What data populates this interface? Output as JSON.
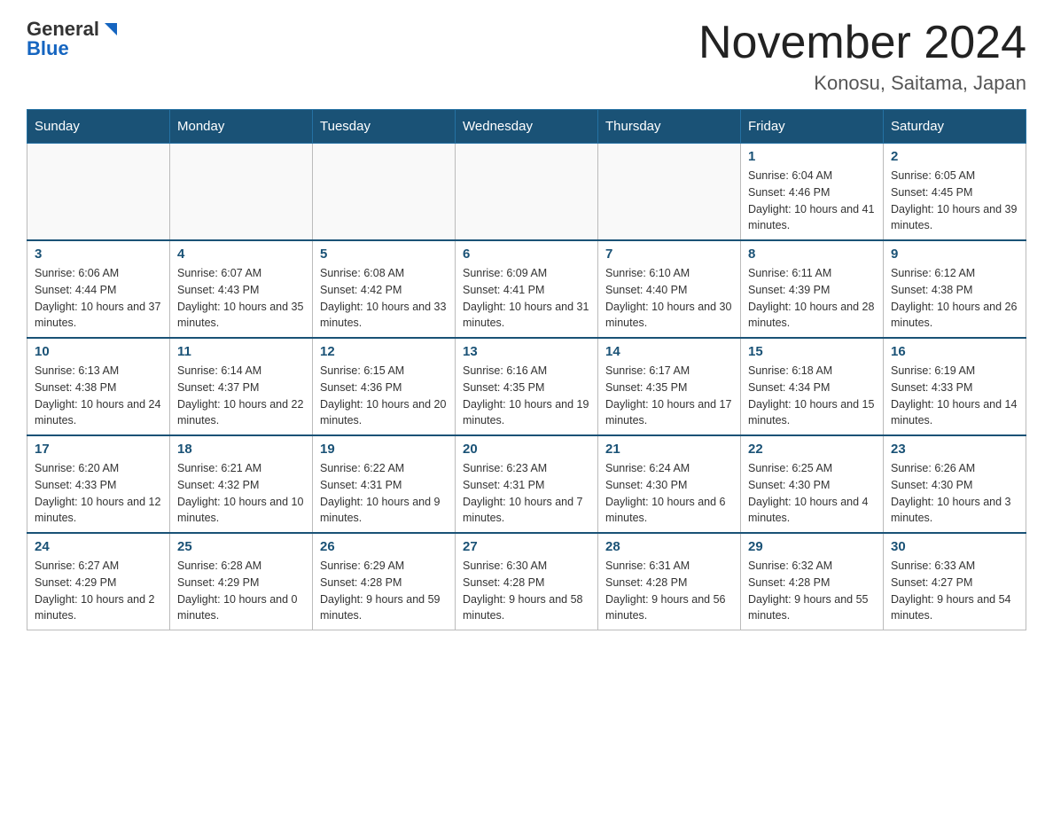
{
  "header": {
    "logo_general": "General",
    "logo_blue": "Blue",
    "title": "November 2024",
    "subtitle": "Konosu, Saitama, Japan"
  },
  "days_of_week": [
    "Sunday",
    "Monday",
    "Tuesday",
    "Wednesday",
    "Thursday",
    "Friday",
    "Saturday"
  ],
  "weeks": [
    [
      {
        "day": "",
        "info": ""
      },
      {
        "day": "",
        "info": ""
      },
      {
        "day": "",
        "info": ""
      },
      {
        "day": "",
        "info": ""
      },
      {
        "day": "",
        "info": ""
      },
      {
        "day": "1",
        "info": "Sunrise: 6:04 AM\nSunset: 4:46 PM\nDaylight: 10 hours and 41 minutes."
      },
      {
        "day": "2",
        "info": "Sunrise: 6:05 AM\nSunset: 4:45 PM\nDaylight: 10 hours and 39 minutes."
      }
    ],
    [
      {
        "day": "3",
        "info": "Sunrise: 6:06 AM\nSunset: 4:44 PM\nDaylight: 10 hours and 37 minutes."
      },
      {
        "day": "4",
        "info": "Sunrise: 6:07 AM\nSunset: 4:43 PM\nDaylight: 10 hours and 35 minutes."
      },
      {
        "day": "5",
        "info": "Sunrise: 6:08 AM\nSunset: 4:42 PM\nDaylight: 10 hours and 33 minutes."
      },
      {
        "day": "6",
        "info": "Sunrise: 6:09 AM\nSunset: 4:41 PM\nDaylight: 10 hours and 31 minutes."
      },
      {
        "day": "7",
        "info": "Sunrise: 6:10 AM\nSunset: 4:40 PM\nDaylight: 10 hours and 30 minutes."
      },
      {
        "day": "8",
        "info": "Sunrise: 6:11 AM\nSunset: 4:39 PM\nDaylight: 10 hours and 28 minutes."
      },
      {
        "day": "9",
        "info": "Sunrise: 6:12 AM\nSunset: 4:38 PM\nDaylight: 10 hours and 26 minutes."
      }
    ],
    [
      {
        "day": "10",
        "info": "Sunrise: 6:13 AM\nSunset: 4:38 PM\nDaylight: 10 hours and 24 minutes."
      },
      {
        "day": "11",
        "info": "Sunrise: 6:14 AM\nSunset: 4:37 PM\nDaylight: 10 hours and 22 minutes."
      },
      {
        "day": "12",
        "info": "Sunrise: 6:15 AM\nSunset: 4:36 PM\nDaylight: 10 hours and 20 minutes."
      },
      {
        "day": "13",
        "info": "Sunrise: 6:16 AM\nSunset: 4:35 PM\nDaylight: 10 hours and 19 minutes."
      },
      {
        "day": "14",
        "info": "Sunrise: 6:17 AM\nSunset: 4:35 PM\nDaylight: 10 hours and 17 minutes."
      },
      {
        "day": "15",
        "info": "Sunrise: 6:18 AM\nSunset: 4:34 PM\nDaylight: 10 hours and 15 minutes."
      },
      {
        "day": "16",
        "info": "Sunrise: 6:19 AM\nSunset: 4:33 PM\nDaylight: 10 hours and 14 minutes."
      }
    ],
    [
      {
        "day": "17",
        "info": "Sunrise: 6:20 AM\nSunset: 4:33 PM\nDaylight: 10 hours and 12 minutes."
      },
      {
        "day": "18",
        "info": "Sunrise: 6:21 AM\nSunset: 4:32 PM\nDaylight: 10 hours and 10 minutes."
      },
      {
        "day": "19",
        "info": "Sunrise: 6:22 AM\nSunset: 4:31 PM\nDaylight: 10 hours and 9 minutes."
      },
      {
        "day": "20",
        "info": "Sunrise: 6:23 AM\nSunset: 4:31 PM\nDaylight: 10 hours and 7 minutes."
      },
      {
        "day": "21",
        "info": "Sunrise: 6:24 AM\nSunset: 4:30 PM\nDaylight: 10 hours and 6 minutes."
      },
      {
        "day": "22",
        "info": "Sunrise: 6:25 AM\nSunset: 4:30 PM\nDaylight: 10 hours and 4 minutes."
      },
      {
        "day": "23",
        "info": "Sunrise: 6:26 AM\nSunset: 4:30 PM\nDaylight: 10 hours and 3 minutes."
      }
    ],
    [
      {
        "day": "24",
        "info": "Sunrise: 6:27 AM\nSunset: 4:29 PM\nDaylight: 10 hours and 2 minutes."
      },
      {
        "day": "25",
        "info": "Sunrise: 6:28 AM\nSunset: 4:29 PM\nDaylight: 10 hours and 0 minutes."
      },
      {
        "day": "26",
        "info": "Sunrise: 6:29 AM\nSunset: 4:28 PM\nDaylight: 9 hours and 59 minutes."
      },
      {
        "day": "27",
        "info": "Sunrise: 6:30 AM\nSunset: 4:28 PM\nDaylight: 9 hours and 58 minutes."
      },
      {
        "day": "28",
        "info": "Sunrise: 6:31 AM\nSunset: 4:28 PM\nDaylight: 9 hours and 56 minutes."
      },
      {
        "day": "29",
        "info": "Sunrise: 6:32 AM\nSunset: 4:28 PM\nDaylight: 9 hours and 55 minutes."
      },
      {
        "day": "30",
        "info": "Sunrise: 6:33 AM\nSunset: 4:27 PM\nDaylight: 9 hours and 54 minutes."
      }
    ]
  ]
}
